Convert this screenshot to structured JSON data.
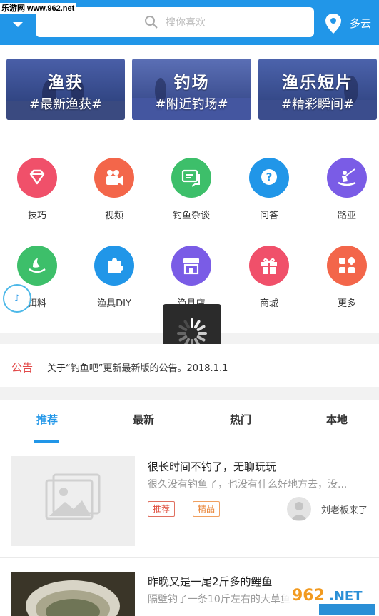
{
  "watermark": "乐游网 www.962.net",
  "header": {
    "search_placeholder": "搜你喜欢",
    "weather": "多云"
  },
  "banners": [
    {
      "title": "渔获",
      "subtitle": "#最新渔获#"
    },
    {
      "title": "钓场",
      "subtitle": "#附近钓场#"
    },
    {
      "title": "渔乐短片",
      "subtitle": "#精彩瞬间#"
    }
  ],
  "categories": [
    {
      "label": "技巧",
      "color": "#f0506a",
      "icon": "diamond-icon"
    },
    {
      "label": "视频",
      "color": "#f3664a",
      "icon": "video-camera-icon"
    },
    {
      "label": "钓鱼杂谈",
      "color": "#3dbf6a",
      "icon": "chat-icon"
    },
    {
      "label": "问答",
      "color": "#2196e8",
      "icon": "question-icon"
    },
    {
      "label": "路亚",
      "color": "#7a5ce6",
      "icon": "lure-fishing-icon"
    },
    {
      "label": "饵料",
      "color": "#3dbf6a",
      "icon": "bait-icon"
    },
    {
      "label": "渔具DIY",
      "color": "#2196e8",
      "icon": "puzzle-icon"
    },
    {
      "label": "渔具店",
      "color": "#7a5ce6",
      "icon": "store-icon"
    },
    {
      "label": "商城",
      "color": "#f0506a",
      "icon": "gift-icon"
    },
    {
      "label": "更多",
      "color": "#f3664a",
      "icon": "more-grid-icon"
    }
  ],
  "notice": {
    "tag": "公告",
    "text": "关于“钓鱼吧”更新最新版的公告。2018.1.1"
  },
  "tabs": [
    "推荐",
    "最新",
    "热门",
    "本地"
  ],
  "active_tab": "推荐",
  "posts": [
    {
      "title": "很长时间不钓了，无聊玩玩",
      "desc": "很久没有钓鱼了，也没有什么好地方去，没...",
      "badges": [
        "推荐",
        "精品"
      ],
      "author": "刘老板来了"
    },
    {
      "title": "昨晚又是一尾2斤多的鲤鱼",
      "desc": "隔壁钓了一条10斤左右的大草鱼"
    }
  ],
  "colors": {
    "accent": "#2196e8",
    "notice": "#e24a4a"
  }
}
